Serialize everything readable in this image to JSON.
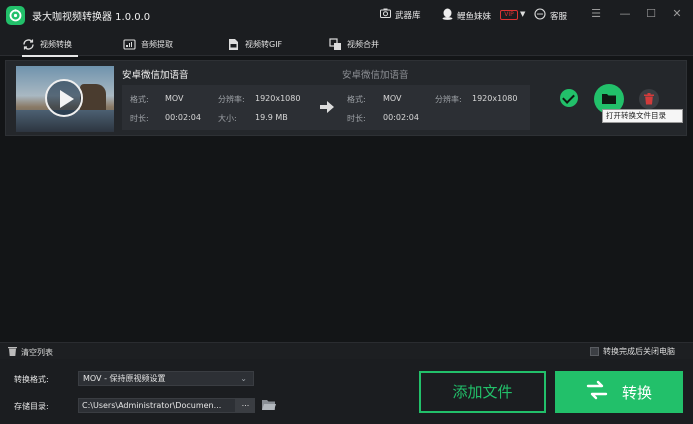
{
  "app": {
    "title": "录大咖视频转换器 1.0.0.0"
  },
  "titlebar": {
    "toolbox_label": "武器库",
    "user_name": "鲤鱼妹妹",
    "vip_badge": "VIP",
    "service_label": "客服"
  },
  "tabs": [
    {
      "label": "视频转换",
      "icon": "video-convert-icon",
      "active": true
    },
    {
      "label": "音频提取",
      "icon": "audio-extract-icon",
      "active": false
    },
    {
      "label": "视频转GIF",
      "icon": "gif-icon",
      "active": false
    },
    {
      "label": "视频合并",
      "icon": "merge-icon",
      "active": false
    }
  ],
  "file": {
    "source_name": "安卓微信加语音",
    "target_name": "安卓微信加语音",
    "format_label": "格式:",
    "resolution_label": "分辨率:",
    "duration_label": "时长:",
    "size_label": "大小:",
    "source_format": "MOV",
    "source_resolution": "1920x1080",
    "source_duration": "00:02:04",
    "source_size": "19.9 MB",
    "target_format": "MOV",
    "target_resolution": "1920x1080",
    "target_duration": "00:02:04",
    "tooltip": "打开转换文件目录"
  },
  "list_footer": {
    "clear_label": "清空列表",
    "shutdown_label": "转换完成后关闭电脑"
  },
  "bottom": {
    "format_label": "转换格式:",
    "format_value": "MOV - 保持原视频设置",
    "path_label": "存储目录:",
    "path_value": "C:\\Users\\Administrator\\Documen...",
    "browse_label": "...",
    "add_label": "添加文件",
    "convert_label": "转换"
  },
  "colors": {
    "accent": "#22c06a",
    "background": "#131517",
    "panel": "#24272b"
  }
}
